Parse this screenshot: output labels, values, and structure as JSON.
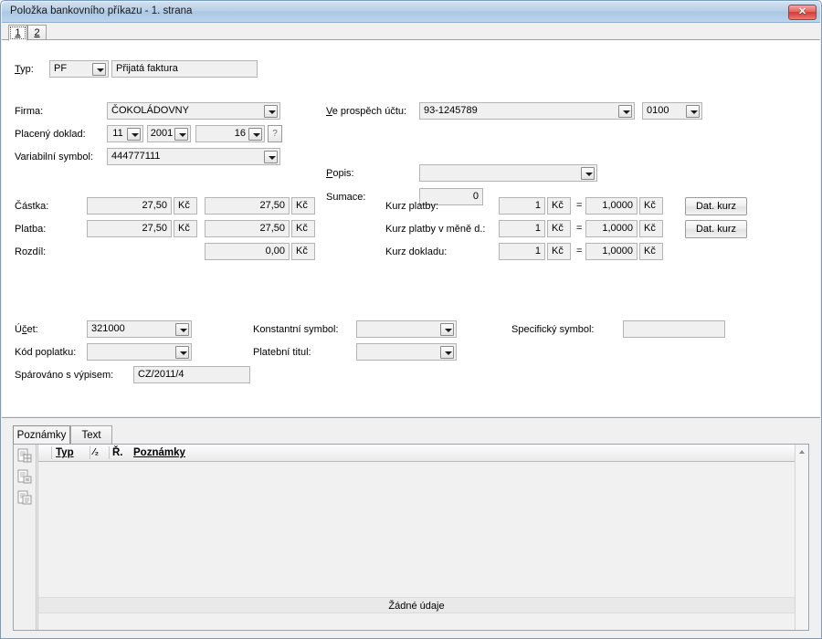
{
  "window": {
    "title": "Položka bankovního příkazu - 1. strana",
    "close_label": "✕"
  },
  "page_tabs": [
    {
      "label": "1",
      "active": true
    },
    {
      "label": "2",
      "active": false
    }
  ],
  "form": {
    "typ": {
      "label": "Typ:",
      "code": "PF",
      "description": "Přijatá faktura"
    },
    "firma": {
      "label": "Firma:",
      "value": "ČOKOLÁDOVNY"
    },
    "placeny_doklad": {
      "label": "Placený doklad:",
      "month": "11",
      "year": "2001",
      "number": "16",
      "help_label": "?"
    },
    "variabilni_symbol": {
      "label": "Variabilní symbol:",
      "value": "444777111"
    },
    "ve_prospech_uctu": {
      "label": "Ve prospěch účtu:",
      "value": "93-1245789",
      "bank_code": "0100"
    },
    "popis": {
      "label": "Popis:",
      "value": ""
    },
    "sumace": {
      "label": "Sumace:",
      "value": "0"
    },
    "castka": {
      "label": "Částka:",
      "value1": "27,50",
      "unit1": "Kč",
      "value2": "27,50",
      "unit2": "Kč"
    },
    "platba": {
      "label": "Platba:",
      "value1": "27,50",
      "unit1": "Kč",
      "value2": "27,50",
      "unit2": "Kč"
    },
    "rozdil": {
      "label": "Rozdíl:",
      "value": "0,00",
      "unit": "Kč"
    },
    "kurz_platby": {
      "label": "Kurz platby:",
      "left": "1",
      "left_unit": "Kč",
      "eq": "=",
      "right": "1,0000",
      "right_unit": "Kč",
      "button": "Dat. kurz"
    },
    "kurz_platby_mena": {
      "label": "Kurz platby v měně d.:",
      "left": "1",
      "left_unit": "Kč",
      "eq": "=",
      "right": "1,0000",
      "right_unit": "Kč",
      "button": "Dat. kurz"
    },
    "kurz_dokladu": {
      "label": "Kurz dokladu:",
      "left": "1",
      "left_unit": "Kč",
      "eq": "=",
      "right": "1,0000",
      "right_unit": "Kč"
    },
    "ucet": {
      "label": "Účet:",
      "value": "321000"
    },
    "kod_poplatku": {
      "label": "Kód poplatku:",
      "value": ""
    },
    "sparovano": {
      "label": "Spárováno s výpisem:",
      "value": "CZ/2011/4"
    },
    "konstantni_symbol": {
      "label": "Konstantní symbol:",
      "value": ""
    },
    "platebni_titul": {
      "label": "Platební titul:",
      "value": ""
    },
    "specificky_symbol": {
      "label": "Specifický symbol:",
      "value": ""
    }
  },
  "notes_panel": {
    "tabs": [
      {
        "label": "Poznámky",
        "active": true
      },
      {
        "label": "Text",
        "active": false
      }
    ],
    "tools": [
      {
        "name": "new-note-icon"
      },
      {
        "name": "edit-note-icon"
      },
      {
        "name": "copy-note-icon"
      }
    ],
    "grid": {
      "columns": [
        "Typ",
        "⁄₂",
        "Ř.",
        "Poznámky"
      ],
      "rows": [],
      "empty_message": "Žádné údaje"
    }
  },
  "colors": {
    "titlebar": "#b7cfe9",
    "close_button": "#cf3b33",
    "field_bg": "#f0f0f0",
    "panel_bg": "#f0f0f0"
  }
}
